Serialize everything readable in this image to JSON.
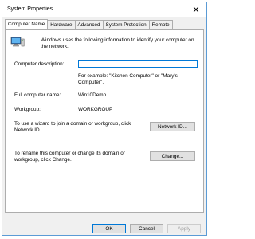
{
  "window": {
    "title": "System Properties",
    "close_glyph": "✕"
  },
  "tabs": [
    {
      "label": "Computer Name",
      "active": true
    },
    {
      "label": "Hardware"
    },
    {
      "label": "Advanced"
    },
    {
      "label": "System Protection"
    },
    {
      "label": "Remote"
    }
  ],
  "panel": {
    "intro": "Windows uses the following information to identify your computer on the network.",
    "description_label": "Computer description:",
    "description_value": "",
    "description_hint": "For example: \"Kitchen Computer\" or \"Mary's Computer\".",
    "full_name_label": "Full computer name:",
    "full_name_value": "Win10Demo",
    "workgroup_label": "Workgroup:",
    "workgroup_value": "WORKGROUP",
    "network_id_text": "To use a wizard to join a domain or workgroup, click Network ID.",
    "network_id_button": "Network ID...",
    "change_text": "To rename this computer or change its domain or workgroup, click Change.",
    "change_button": "Change..."
  },
  "footer": {
    "ok": "OK",
    "cancel": "Cancel",
    "apply": "Apply"
  },
  "colors": {
    "accent": "#0078d7",
    "frame": "#5b9bd5"
  },
  "icons": {
    "computer": "computer-icon"
  }
}
